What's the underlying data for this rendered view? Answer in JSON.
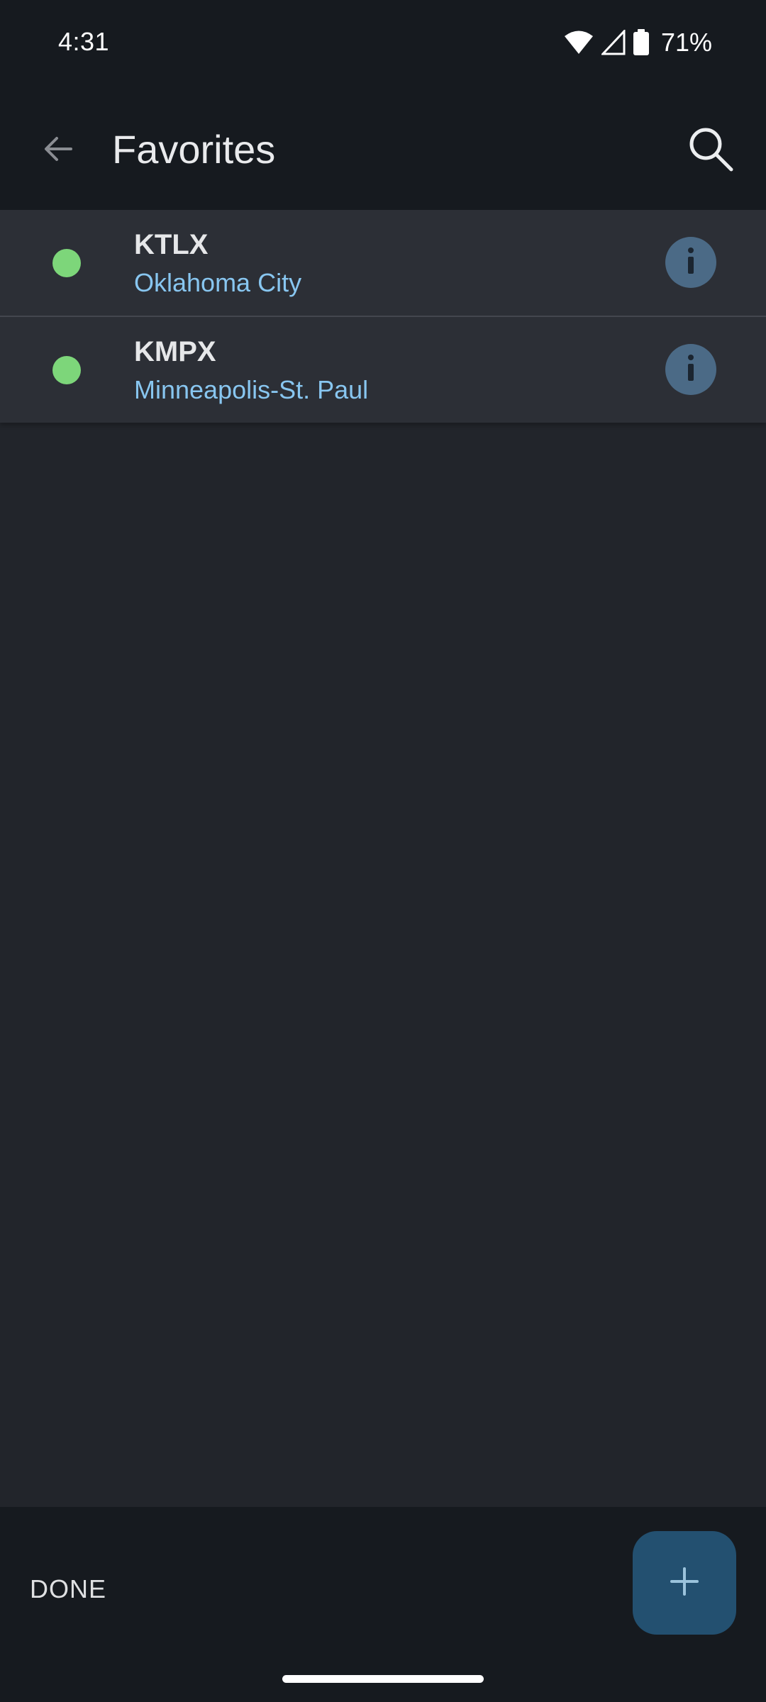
{
  "status_bar": {
    "time": "4:31",
    "battery_percent": "71%",
    "icons": [
      "wifi-icon",
      "signal-icon",
      "battery-icon"
    ]
  },
  "app_bar": {
    "title": "Favorites",
    "back_icon": "arrow-back-icon",
    "search_icon": "search-icon"
  },
  "stations": [
    {
      "callsign": "KTLX",
      "city": "Oklahoma City",
      "status_color": "#7dd67a"
    },
    {
      "callsign": "KMPX",
      "city": "Minneapolis-St. Paul",
      "status_color": "#7dd67a"
    }
  ],
  "bottom_bar": {
    "done_label": "DONE",
    "add_icon": "plus-icon"
  },
  "colors": {
    "background": "#22252b",
    "bar_background": "#161a1f",
    "row_background": "#2c2f36",
    "city_text": "#88c6f0",
    "info_button": "#4b6a86",
    "fab": "#235070"
  }
}
